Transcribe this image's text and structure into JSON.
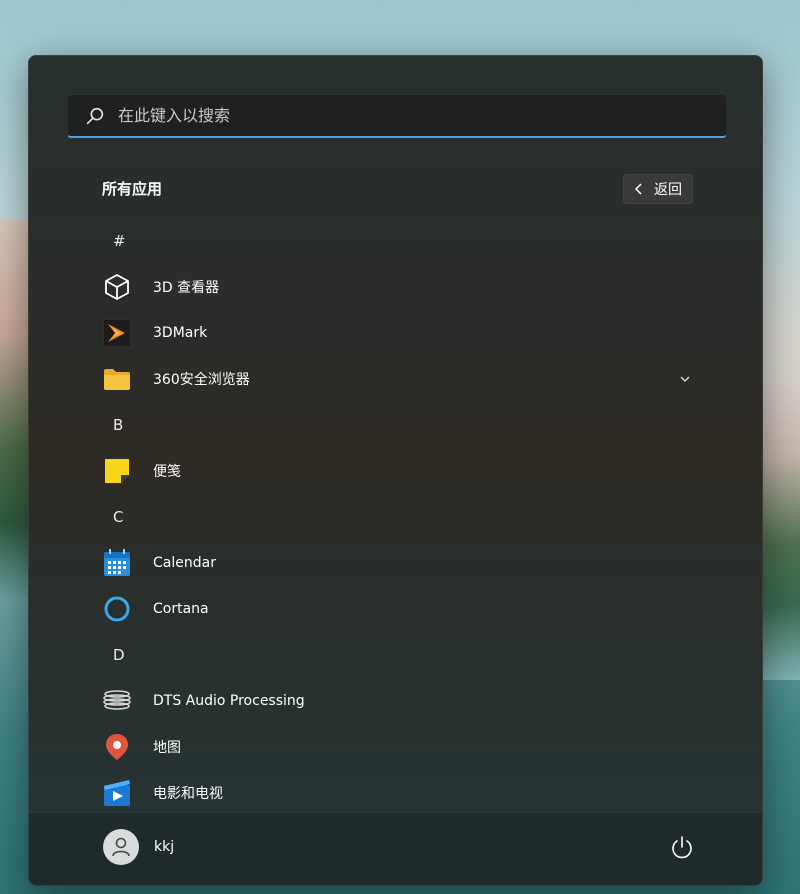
{
  "search": {
    "placeholder": "在此键入以搜索"
  },
  "header": {
    "title": "所有应用",
    "back_label": "返回"
  },
  "apps": [
    {
      "letter": "#"
    },
    {
      "label": "3D 查看器",
      "icon": "cube-icon"
    },
    {
      "label": "3DMark",
      "icon": "3dmark-icon"
    },
    {
      "label": "360安全浏览器",
      "icon": "folder-icon",
      "expandable": true
    },
    {
      "letter": "B"
    },
    {
      "label": "便笺",
      "icon": "sticky-notes-icon"
    },
    {
      "letter": "C"
    },
    {
      "label": "Calendar",
      "icon": "calendar-icon"
    },
    {
      "label": "Cortana",
      "icon": "cortana-icon"
    },
    {
      "letter": "D"
    },
    {
      "label": "DTS Audio Processing",
      "icon": "dts-icon"
    },
    {
      "label": "地图",
      "icon": "maps-icon"
    },
    {
      "label": "电影和电视",
      "icon": "movies-tv-icon"
    }
  ],
  "footer": {
    "user_name": "kkj"
  },
  "colors": {
    "accent": "#4aa3e0",
    "folder": "#f5c342",
    "sticky": "#f7d51d",
    "maps": "#e2553c"
  }
}
